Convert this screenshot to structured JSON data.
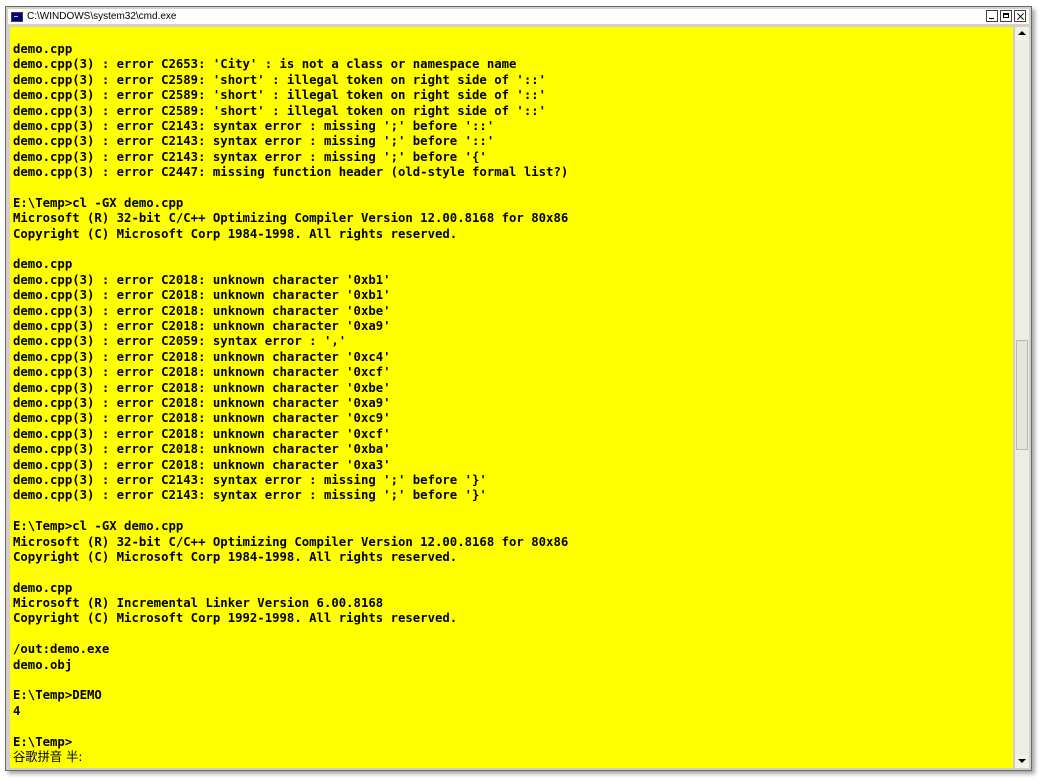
{
  "window": {
    "title": "C:\\WINDOWS\\system32\\cmd.exe",
    "icon": "console-icon",
    "buttons": [
      "minimize",
      "maximize",
      "close"
    ]
  },
  "console": {
    "background": "#ffff00",
    "foreground": "#000000",
    "lines": [
      "demo.cpp",
      "demo.cpp(3) : error C2653: 'City' : is not a class or namespace name",
      "demo.cpp(3) : error C2589: 'short' : illegal token on right side of '::'",
      "demo.cpp(3) : error C2589: 'short' : illegal token on right side of '::'",
      "demo.cpp(3) : error C2589: 'short' : illegal token on right side of '::'",
      "demo.cpp(3) : error C2143: syntax error : missing ';' before '::'",
      "demo.cpp(3) : error C2143: syntax error : missing ';' before '::'",
      "demo.cpp(3) : error C2143: syntax error : missing ';' before '{'",
      "demo.cpp(3) : error C2447: missing function header (old-style formal list?)",
      "",
      "E:\\Temp>cl -GX demo.cpp",
      "Microsoft (R) 32-bit C/C++ Optimizing Compiler Version 12.00.8168 for 80x86",
      "Copyright (C) Microsoft Corp 1984-1998. All rights reserved.",
      "",
      "demo.cpp",
      "demo.cpp(3) : error C2018: unknown character '0xb1'",
      "demo.cpp(3) : error C2018: unknown character '0xb1'",
      "demo.cpp(3) : error C2018: unknown character '0xbe'",
      "demo.cpp(3) : error C2018: unknown character '0xa9'",
      "demo.cpp(3) : error C2059: syntax error : ','",
      "demo.cpp(3) : error C2018: unknown character '0xc4'",
      "demo.cpp(3) : error C2018: unknown character '0xcf'",
      "demo.cpp(3) : error C2018: unknown character '0xbe'",
      "demo.cpp(3) : error C2018: unknown character '0xa9'",
      "demo.cpp(3) : error C2018: unknown character '0xc9'",
      "demo.cpp(3) : error C2018: unknown character '0xcf'",
      "demo.cpp(3) : error C2018: unknown character '0xba'",
      "demo.cpp(3) : error C2018: unknown character '0xa3'",
      "demo.cpp(3) : error C2143: syntax error : missing ';' before '}'",
      "demo.cpp(3) : error C2143: syntax error : missing ';' before '}'",
      "",
      "E:\\Temp>cl -GX demo.cpp",
      "Microsoft (R) 32-bit C/C++ Optimizing Compiler Version 12.00.8168 for 80x86",
      "Copyright (C) Microsoft Corp 1984-1998. All rights reserved.",
      "",
      "demo.cpp",
      "Microsoft (R) Incremental Linker Version 6.00.8168",
      "Copyright (C) Microsoft Corp 1992-1998. All rights reserved.",
      "",
      "/out:demo.exe",
      "demo.obj",
      "",
      "E:\\Temp>DEMO",
      "4",
      "",
      "E:\\Temp>"
    ],
    "ime_status": "谷歌拼音 半:"
  },
  "scrollbar": {
    "position_fraction": 0.42
  }
}
